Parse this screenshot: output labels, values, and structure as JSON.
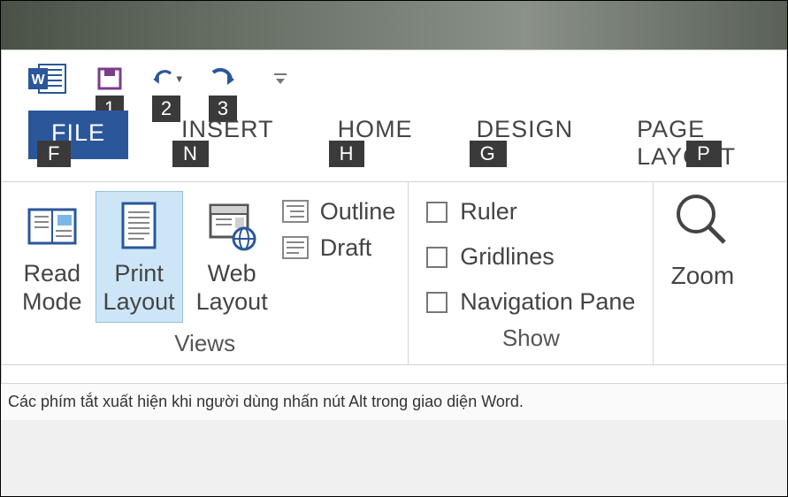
{
  "qat": {
    "tips": {
      "save": "1",
      "undo": "2",
      "redo": "3"
    }
  },
  "tabs": {
    "file": {
      "label": "FILE",
      "tip": "F"
    },
    "insert": {
      "label": "INSERT",
      "tip": "N"
    },
    "home": {
      "label": "HOME",
      "tip": "H"
    },
    "design": {
      "label": "DESIGN",
      "tip": "G"
    },
    "page": {
      "label": "PAGE LAYOUT",
      "tip": "P"
    }
  },
  "views": {
    "read": "Read\nMode",
    "print": "Print\nLayout",
    "web": "Web\nLayout",
    "outline": "Outline",
    "draft": "Draft",
    "group": "Views"
  },
  "show": {
    "ruler": "Ruler",
    "grid": "Gridlines",
    "nav": "Navigation Pane",
    "group": "Show"
  },
  "zoom": {
    "label": "Zoom"
  },
  "caption": "Các phím tắt xuất hiện khi người dùng nhấn nút Alt trong giao diện Word."
}
